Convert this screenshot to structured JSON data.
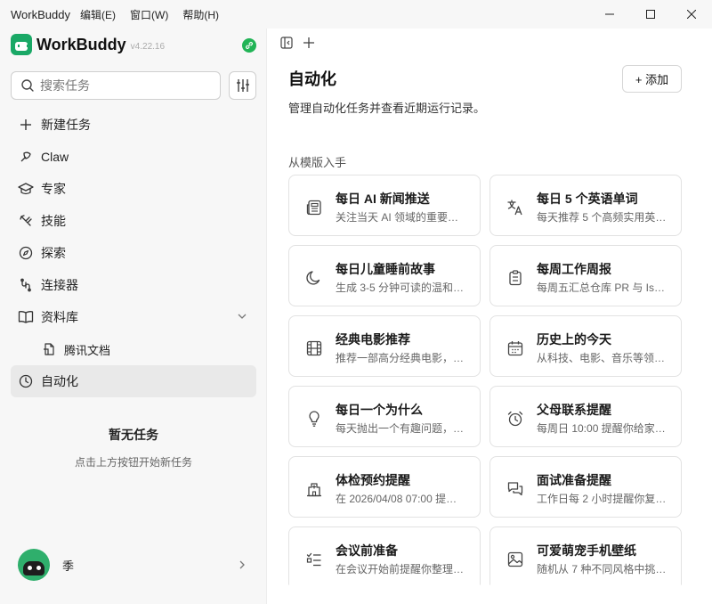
{
  "titlebar": {
    "app_name": "WorkBuddy",
    "menus": [
      "编辑(E)",
      "窗口(W)",
      "帮助(H)"
    ]
  },
  "sidebar": {
    "brand": {
      "name": "WorkBuddy",
      "version": "v4.22.16"
    },
    "search": {
      "placeholder": "搜索任务",
      "value": ""
    },
    "nav": [
      {
        "label": "新建任务",
        "icon": "plus-icon"
      },
      {
        "label": "Claw",
        "icon": "claw-icon"
      },
      {
        "label": "专家",
        "icon": "graduation-cap-icon"
      },
      {
        "label": "技能",
        "icon": "skill-icon"
      },
      {
        "label": "探索",
        "icon": "compass-icon"
      },
      {
        "label": "连接器",
        "icon": "connector-icon"
      },
      {
        "label": "资料库",
        "icon": "book-icon"
      },
      {
        "label": "腾讯文档",
        "icon": "tencent-docs-icon"
      },
      {
        "label": "自动化",
        "icon": "clock-icon"
      }
    ],
    "empty": {
      "title": "暂无任务",
      "subtitle": "点击上方按钮开始新任务"
    },
    "user": {
      "name": "季"
    }
  },
  "main": {
    "title": "自动化",
    "add_label": "+ 添加",
    "description": "管理自动化任务并查看近期运行记录。",
    "section_label": "从模版入手",
    "templates": [
      {
        "title": "每日 AI 新闻推送",
        "desc": "关注当天 AI 领域的重要…",
        "icon": "newspaper-icon"
      },
      {
        "title": "每日 5 个英语单词",
        "desc": "每天推荐 5 个高频实用英…",
        "icon": "translate-icon"
      },
      {
        "title": "每日儿童睡前故事",
        "desc": "生成 3-5 分钟可读的温和…",
        "icon": "moon-icon"
      },
      {
        "title": "每周工作周报",
        "desc": "每周五汇总仓库 PR 与 Is…",
        "icon": "clipboard-icon"
      },
      {
        "title": "经典电影推荐",
        "desc": "推荐一部高分经典电影，…",
        "icon": "film-icon"
      },
      {
        "title": "历史上的今天",
        "desc": "从科技、电影、音乐等领…",
        "icon": "calendar-icon"
      },
      {
        "title": "每日一个为什么",
        "desc": "每天抛出一个有趣问题，…",
        "icon": "lightbulb-icon"
      },
      {
        "title": "父母联系提醒",
        "desc": "每周日 10:00 提醒你给家…",
        "icon": "alarm-clock-icon"
      },
      {
        "title": "体检预约提醒",
        "desc": "在 2026/04/08 07:00 提…",
        "icon": "hospital-icon"
      },
      {
        "title": "面试准备提醒",
        "desc": "工作日每 2 小时提醒你复…",
        "icon": "chat-icon"
      },
      {
        "title": "会议前准备",
        "desc": "在会议开始前提醒你整理…",
        "icon": "checklist-icon"
      },
      {
        "title": "可爱萌宠手机壁纸",
        "desc": "随机从 7 种不同风格中挑…",
        "icon": "image-icon"
      }
    ]
  }
}
